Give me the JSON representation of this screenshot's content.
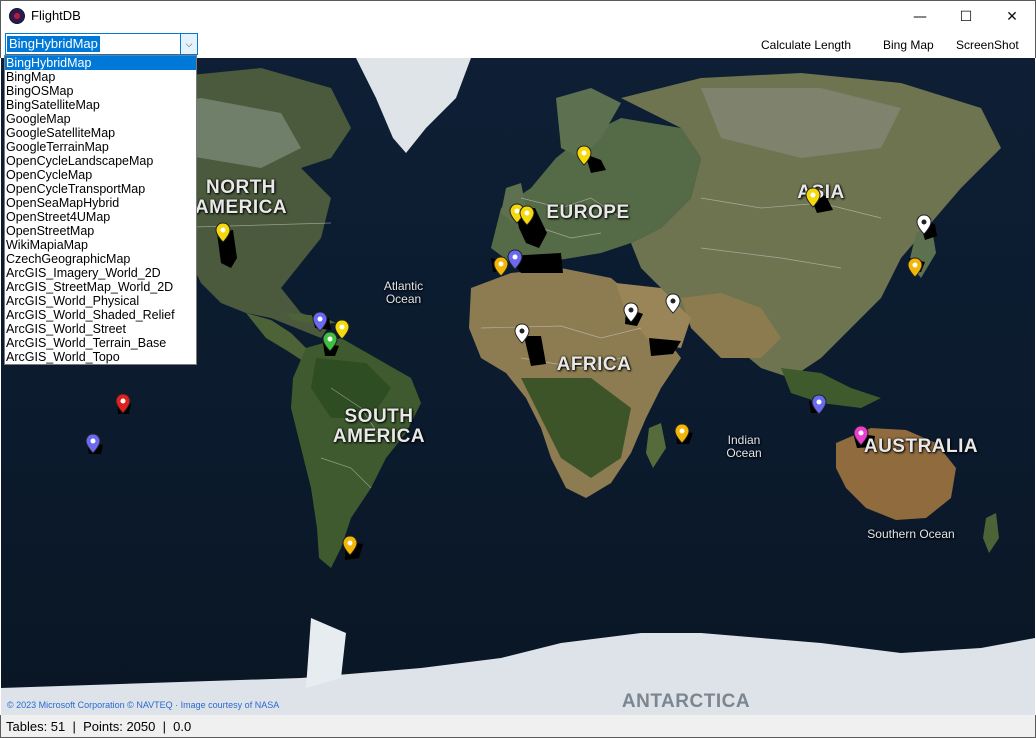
{
  "window": {
    "title": "FlightDB"
  },
  "window_controls": {
    "minimize": "—",
    "maximize": "☐",
    "close": "✕"
  },
  "toolbar": {
    "map_selected": "BingHybridMap",
    "calculate_length": "Calculate Length",
    "bing_map": "Bing Map",
    "screenshot": "ScreenShot"
  },
  "map_options": [
    "BingHybridMap",
    "BingMap",
    "BingOSMap",
    "BingSatelliteMap",
    "GoogleMap",
    "GoogleSatelliteMap",
    "GoogleTerrainMap",
    "OpenCycleLandscapeMap",
    "OpenCycleMap",
    "OpenCycleTransportMap",
    "OpenSeaMapHybrid",
    "OpenStreet4UMap",
    "OpenStreetMap",
    "WikiMapiaMap",
    "CzechGeographicMap",
    "ArcGIS_Imagery_World_2D",
    "ArcGIS_StreetMap_World_2D",
    "ArcGIS_World_Physical",
    "ArcGIS_World_Shaded_Relief",
    "ArcGIS_World_Street",
    "ArcGIS_World_Terrain_Base",
    "ArcGIS_World_Topo"
  ],
  "map": {
    "labels": {
      "north_america": "NORTH\nAMERICA",
      "europe": "EUROPE",
      "asia": "ASIA",
      "africa": "AFRICA",
      "south_america": "SOUTH\nAMERICA",
      "australia": "AUSTRALIA",
      "antarctica": "ANTARCTICA",
      "atlantic": "Atlantic\nOcean",
      "indian": "Indian\nOcean",
      "southern": "Southern Ocean"
    },
    "attribution": "© 2023 Microsoft Corporation © NAVTEQ · Image courtesy of NASA",
    "marker_colors": {
      "yellow": "#f5d90a",
      "white": "#ffffff",
      "orange": "#f2b705",
      "blue": "#6a6af0",
      "green": "#3fbf3f",
      "red": "#e02020",
      "magenta": "#e83fd0"
    }
  },
  "status": {
    "text": "Tables: 51  |  Points: 2050  |  0.0"
  }
}
